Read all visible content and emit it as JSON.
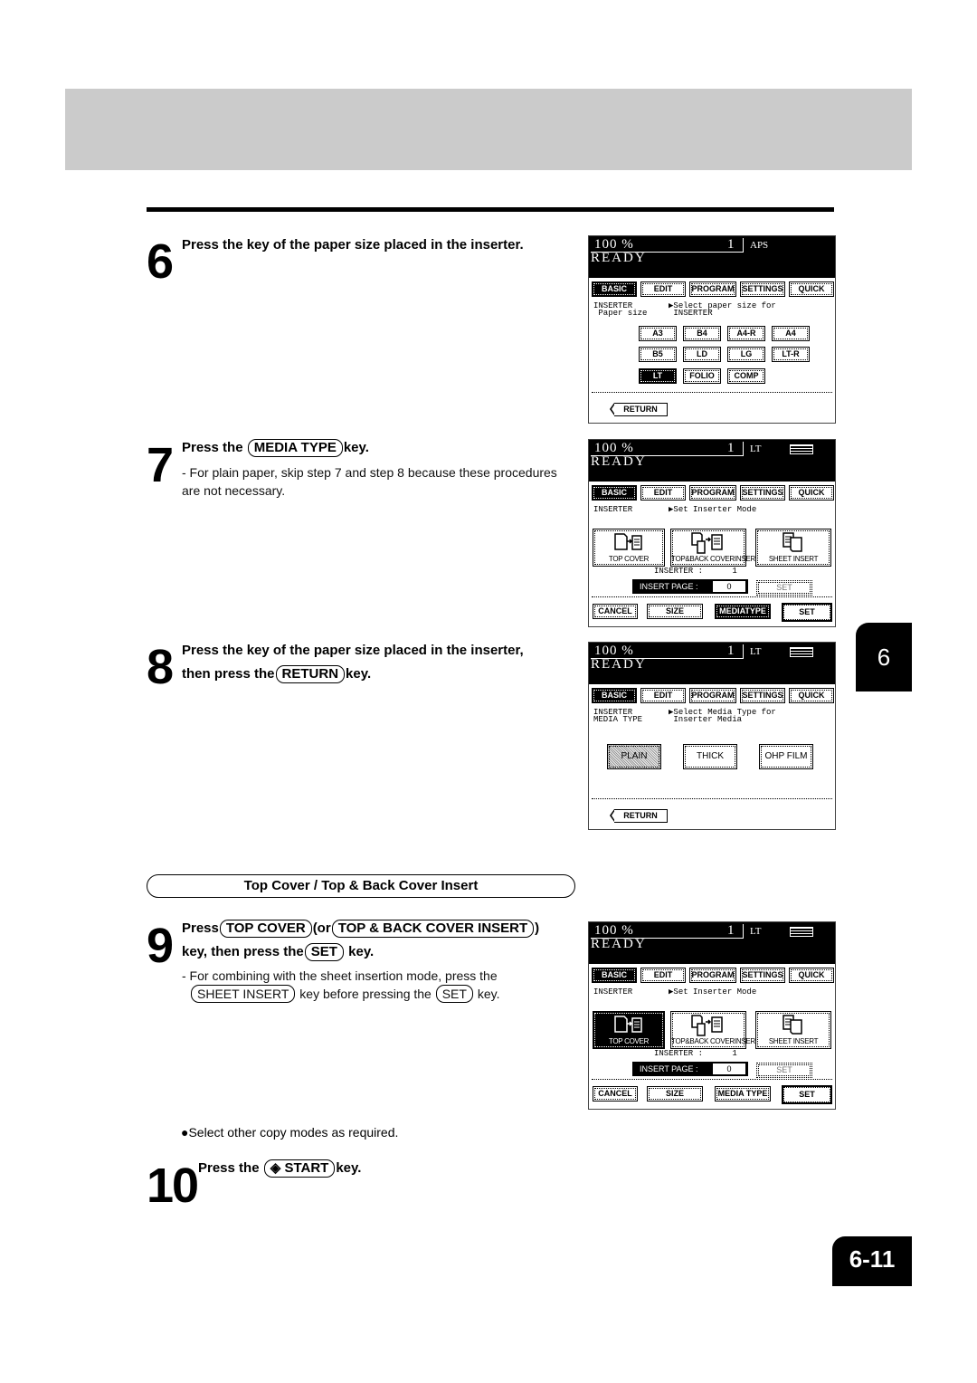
{
  "page": {
    "chapter_tab": "6",
    "page_number": "6-11"
  },
  "steps": [
    {
      "number": "6",
      "title": "Press the key of the paper size placed in the inserter."
    },
    {
      "number": "7",
      "title_pre": "Press the",
      "title_key": "MEDIA TYPE",
      "title_post": "key.",
      "note": "- For plain paper, skip step 7 and step 8 because these procedures are not necessary."
    },
    {
      "number": "8",
      "title_line1": "Press the key of the paper size placed in the inserter,",
      "title_pre": "then press the",
      "title_key": "RETURN",
      "title_post": "key."
    },
    {
      "number": "9",
      "title_pre": "Press",
      "title_key1": "TOP COVER",
      "title_mid": "(or",
      "title_key2": "TOP & BACK COVER  INSERT",
      "title_end": ")",
      "title_line2_pre": "key, then press the",
      "title_line2_key": "SET",
      "title_line2_post": "key.",
      "note_line1": "- For combining with the sheet insertion mode, press the",
      "note_key1": "SHEET INSERT",
      "note_mid": "key before pressing the",
      "note_key2": "SET",
      "note_end": "key."
    },
    {
      "number": "10",
      "title_pre": "Press the",
      "title_key": "START",
      "title_key_icon": "start-diamond-icon",
      "title_post": "key."
    }
  ],
  "section_header": "Top Cover / Top & Back Cover Insert",
  "bullet_note": "Select other copy modes as required.",
  "lcd_common": {
    "zoom": "100  %",
    "copies": "1",
    "status": "READY",
    "tabs": [
      "BASIC",
      "EDIT",
      "PROGRAM",
      "SETTINGS",
      "QUICK"
    ],
    "active_tab": "BASIC"
  },
  "lcd1": {
    "paper": "APS",
    "info_left": "INSERTER\n Paper size",
    "info_right": "▶Select paper size for\n INSERTER",
    "sizes": [
      "A3",
      "B4",
      "A4-R",
      "A4",
      "B5",
      "LD",
      "LG",
      "LT-R",
      "LT",
      "FOLIO",
      "COMP"
    ],
    "selected_size": "LT",
    "return_label": "RETURN"
  },
  "lcd2": {
    "paper": "LT",
    "info_left": "INSERTER",
    "info_right": "▶Set Inserter Mode",
    "modes": [
      "TOP COVER",
      "TOP&BACK COVERINSERT",
      "SHEET INSERT"
    ],
    "inserter_line": "INSERTER :      1",
    "insert_page_label": "INSERT PAGE :",
    "insert_page_value": "0",
    "set_small": "SET",
    "bottom": [
      "CANCEL",
      "SIZE",
      "MEDIATYPE",
      "SET"
    ]
  },
  "lcd3": {
    "paper": "LT",
    "info_left": "INSERTER\nMEDIA TYPE",
    "info_right": "▶Select Media Type for\n Inserter Media",
    "media": [
      "PLAIN",
      "THICK",
      "OHP FILM"
    ],
    "selected_media": "PLAIN",
    "return_label": "RETURN"
  },
  "lcd4": {
    "paper": "LT",
    "info_left": "INSERTER",
    "info_right": "▶Set Inserter Mode",
    "modes": [
      "TOP COVER",
      "TOP&BACK COVERINSERT",
      "SHEET INSERT"
    ],
    "selected_mode": "TOP COVER",
    "inserter_line": "INSERTER :      1",
    "insert_page_label": "INSERT PAGE :",
    "insert_page_value": "0",
    "set_small": "SET",
    "bottom": [
      "CANCEL",
      "SIZE",
      "MEDIA TYPE",
      "SET"
    ]
  }
}
